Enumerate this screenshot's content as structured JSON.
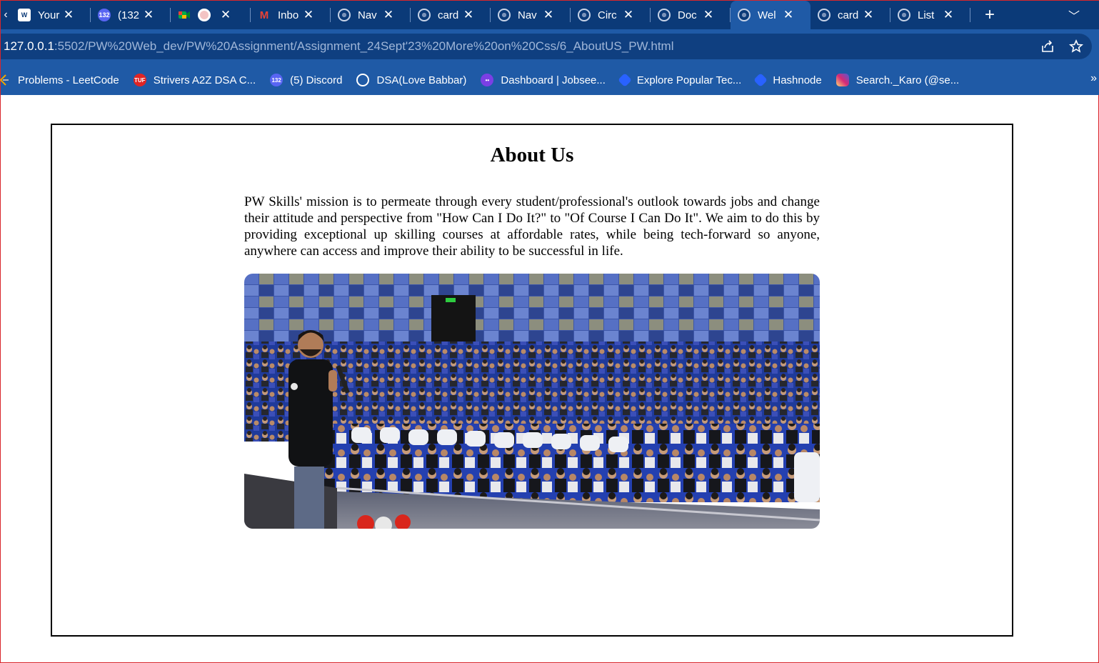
{
  "browser": {
    "tabs": [
      {
        "title": "Your",
        "icon": "wordpress-icon",
        "active": false
      },
      {
        "title": "(132",
        "icon": "discord-icon",
        "active": false,
        "badge": "132"
      },
      {
        "title": "",
        "icon": "google-meet-icon",
        "active": false
      },
      {
        "title": "",
        "icon": "recording-icon",
        "active": false
      },
      {
        "title": "Inbo",
        "icon": "gmail-icon",
        "active": false
      },
      {
        "title": "Nav",
        "icon": "globe-icon",
        "active": false
      },
      {
        "title": "card",
        "icon": "globe-icon",
        "active": false
      },
      {
        "title": "Nav",
        "icon": "globe-icon",
        "active": false
      },
      {
        "title": "Circ",
        "icon": "globe-icon",
        "active": false
      },
      {
        "title": "Doc",
        "icon": "globe-icon",
        "active": false
      },
      {
        "title": "Wel",
        "icon": "globe-icon",
        "active": true
      },
      {
        "title": "card",
        "icon": "globe-icon",
        "active": false
      },
      {
        "title": "List",
        "icon": "globe-icon",
        "active": false
      }
    ],
    "url_host": "127.0.0.1",
    "url_path": ":5502/PW%20Web_dev/PW%20Assignment/Assignment_24Sept'23%20More%20on%20Css/6_AboutUS_PW.html",
    "bookmarks": [
      {
        "label": "Problems - LeetCode",
        "icon": "leetcode-icon",
        "color": "#f0a500"
      },
      {
        "label": "Strivers A2Z DSA C...",
        "icon": "tuf-icon",
        "color": "#e02424"
      },
      {
        "label": "(5) Discord",
        "icon": "discord-icon",
        "color": "#5865f2"
      },
      {
        "label": "DSA(Love Babbar)",
        "icon": "globe-icon",
        "color": "#ffffff"
      },
      {
        "label": "Dashboard | Jobsee...",
        "icon": "jobseeker-icon",
        "color": "#7b3fe4"
      },
      {
        "label": "Explore Popular Tec...",
        "icon": "hashnode-icon",
        "color": "#2962ff"
      },
      {
        "label": "Hashnode",
        "icon": "hashnode-icon",
        "color": "#2962ff"
      },
      {
        "label": "Search._Karo (@se...",
        "icon": "instagram-icon",
        "color": "#d62976"
      }
    ]
  },
  "page": {
    "title": "About Us",
    "paragraph": "PW Skills' mission is to permeate through every student/professional's outlook towards jobs and change their attitude and perspective from \"How Can I Do It?\" to \"Of Course I Can Do It\". We aim to do this by providing exceptional up skilling courses at affordable rates, while being tech-forward so anyone, anywhere can access and improve their ability to be successful in life."
  },
  "colors": {
    "tabstrip": "#0b3a78",
    "toolbar": "#1f5aa6",
    "page_border": "#000000"
  }
}
